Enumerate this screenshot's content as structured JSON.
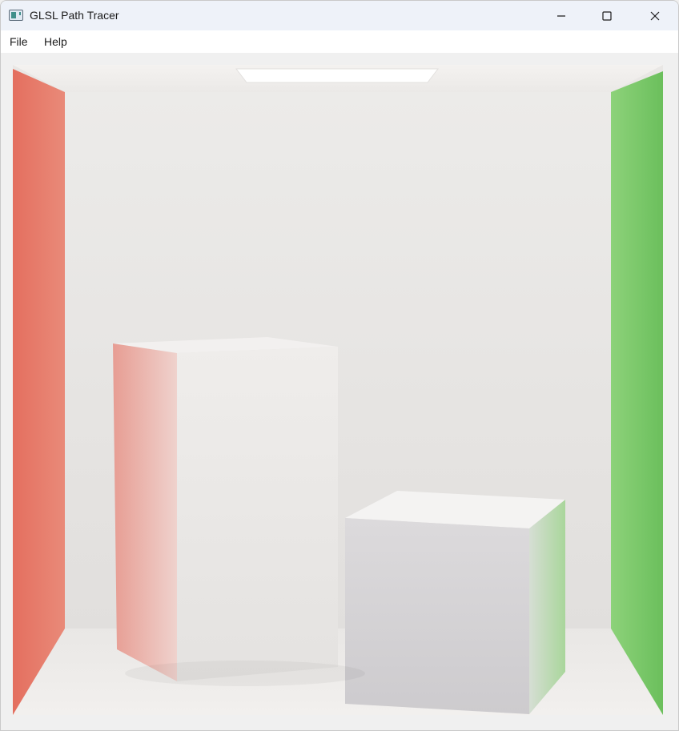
{
  "window": {
    "title": "GLSL Path Tracer",
    "icon": "app-window-icon"
  },
  "titlebar_controls": {
    "minimize": "minimize-icon",
    "maximize": "maximize-icon",
    "close": "close-icon"
  },
  "menu": {
    "items": [
      {
        "label": "File"
      },
      {
        "label": "Help"
      }
    ]
  },
  "scene": {
    "description_tags": [
      "cornell-box",
      "red-left-wall",
      "green-right-wall",
      "area-light",
      "tall-box",
      "short-box"
    ],
    "colors": {
      "left_wall": "#e07868",
      "right_wall": "#7cc96a",
      "back_wall": "#e8e6e4",
      "ceiling": "#f3f1ef",
      "floor": "#efedeb",
      "light": "#ffffff"
    }
  }
}
